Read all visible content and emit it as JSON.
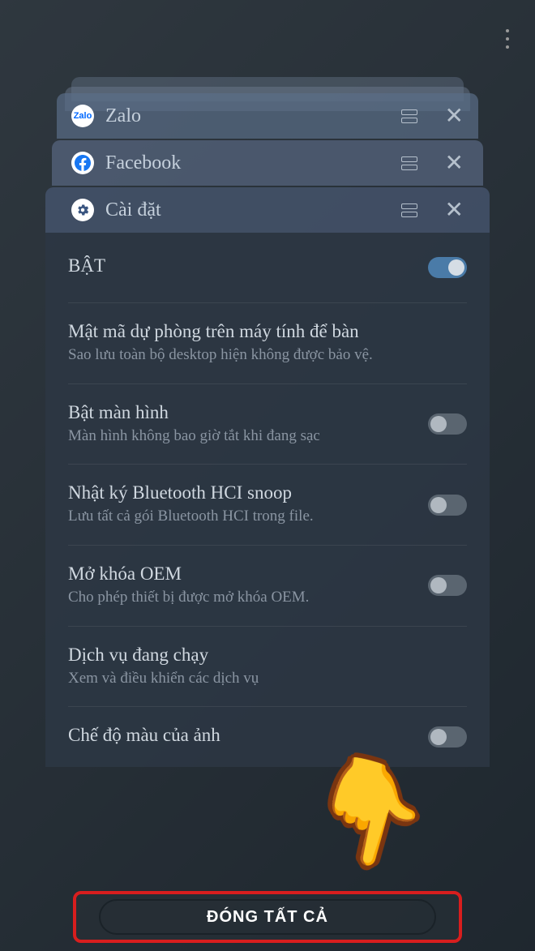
{
  "more_menu": "more-options",
  "apps": {
    "zalo": {
      "name": "Zalo",
      "icon_label": "Zalo"
    },
    "facebook": {
      "name": "Facebook"
    },
    "settings": {
      "name": "Cài đặt"
    }
  },
  "settings_panel": {
    "master": {
      "title": "BẬT",
      "enabled": true
    },
    "items": [
      {
        "title": "Mật mã dự phòng trên máy tính để bàn",
        "sub": "Sao lưu toàn bộ desktop hiện không được bảo vệ.",
        "has_toggle": false
      },
      {
        "title": "Bật màn hình",
        "sub": "Màn hình không bao giờ tắt khi đang sạc",
        "has_toggle": true,
        "enabled": false
      },
      {
        "title": "Nhật ký Bluetooth HCI snoop",
        "sub": "Lưu tất cả gói Bluetooth HCI trong file.",
        "has_toggle": true,
        "enabled": false
      },
      {
        "title": "Mở khóa OEM",
        "sub": "Cho phép thiết bị được mở khóa OEM.",
        "has_toggle": true,
        "enabled": false
      },
      {
        "title": "Dịch vụ đang chạy",
        "sub": "Xem và điều khiển các dịch vụ",
        "has_toggle": false
      },
      {
        "title": "Chế độ màu của ảnh",
        "sub": "",
        "has_toggle": true,
        "enabled": false
      }
    ]
  },
  "close_all_button": "ĐÓNG TẤT CẢ",
  "pointer_emoji": "👇"
}
